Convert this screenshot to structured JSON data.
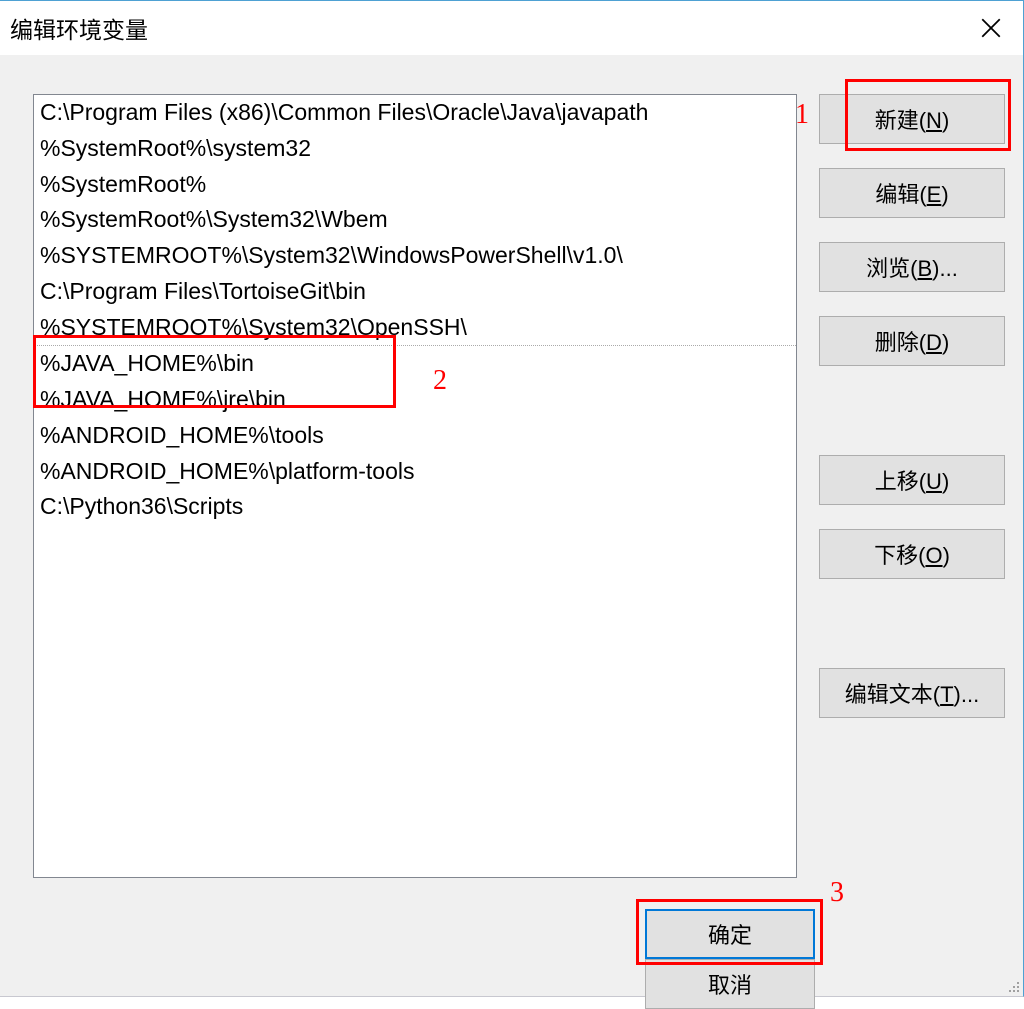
{
  "title": "编辑环境变量",
  "list": [
    "C:\\Program Files (x86)\\Common Files\\Oracle\\Java\\javapath",
    "%SystemRoot%\\system32",
    "%SystemRoot%",
    "%SystemRoot%\\System32\\Wbem",
    "%SYSTEMROOT%\\System32\\WindowsPowerShell\\v1.0\\",
    "C:\\Program Files\\TortoiseGit\\bin",
    "%SYSTEMROOT%\\System32\\OpenSSH\\",
    "%JAVA_HOME%\\bin",
    "%JAVA_HOME%\\jre\\bin",
    "%ANDROID_HOME%\\tools",
    "%ANDROID_HOME%\\platform-tools",
    "C:\\Python36\\Scripts"
  ],
  "buttons": {
    "new_prefix": "新建(",
    "new_key": "N",
    "new_suffix": ")",
    "edit_prefix": "编辑(",
    "edit_key": "E",
    "edit_suffix": ")",
    "browse_prefix": "浏览(",
    "browse_key": "B",
    "browse_suffix": ")...",
    "delete_prefix": "删除(",
    "delete_key": "D",
    "delete_suffix": ")",
    "moveup_prefix": "上移(",
    "moveup_key": "U",
    "moveup_suffix": ")",
    "movedown_prefix": "下移(",
    "movedown_key": "O",
    "movedown_suffix": ")",
    "edittext_prefix": "编辑文本(",
    "edittext_key": "T",
    "edittext_suffix": ")...",
    "ok": "确定",
    "cancel": "取消"
  },
  "annotations": {
    "one": "1",
    "two": "2",
    "three": "3"
  }
}
